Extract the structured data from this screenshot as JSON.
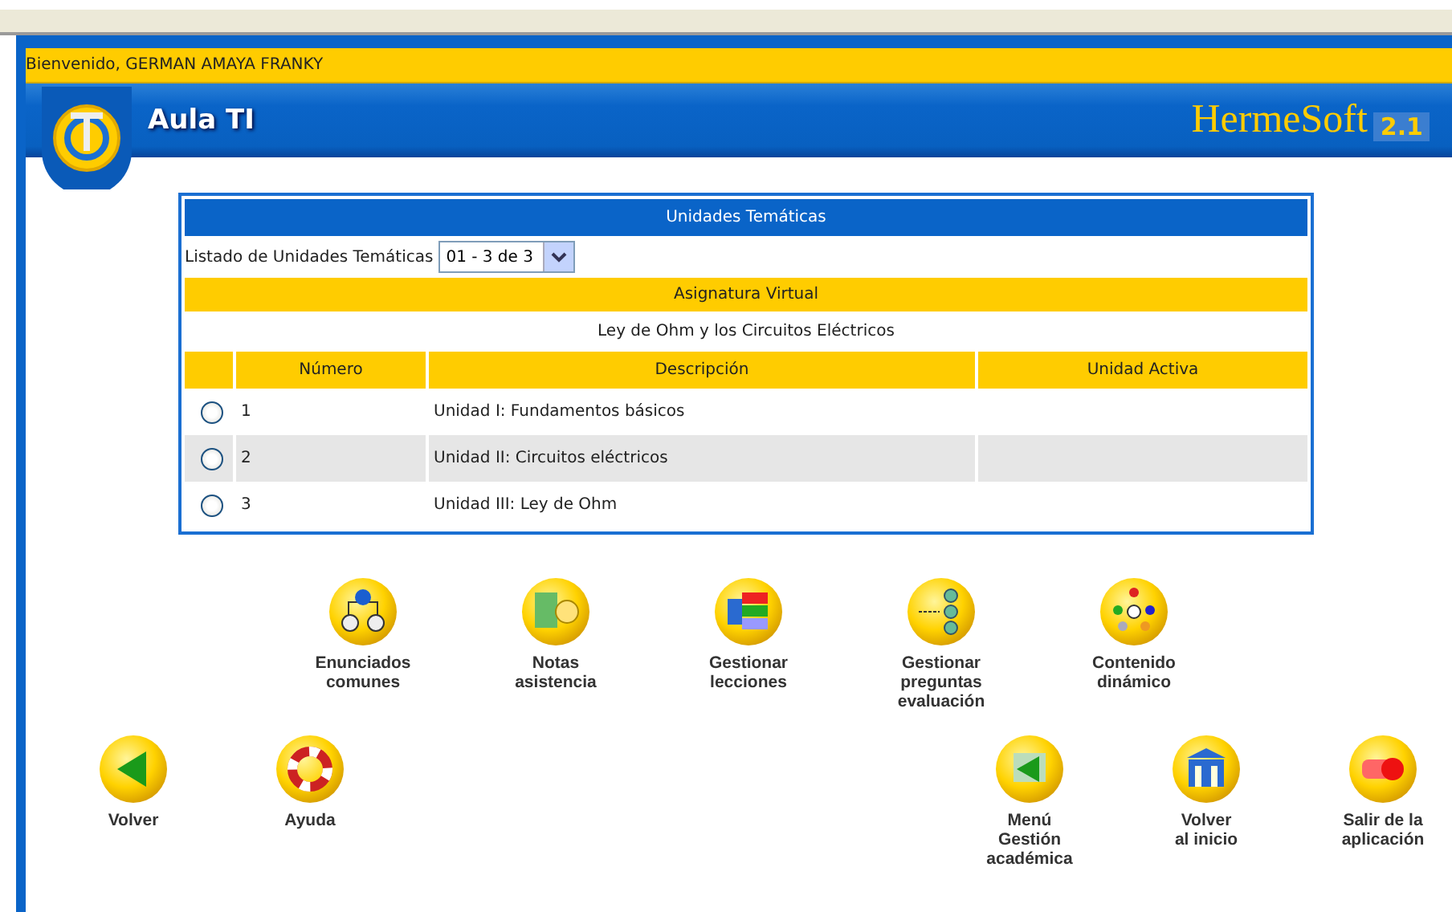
{
  "welcome": "Bienvenido, GERMAN AMAYA FRANKY",
  "header": {
    "title": "Aula TI",
    "brand": "HermeSoft",
    "version": "2.1"
  },
  "panel": {
    "title": "Unidades Temáticas",
    "list_label": "Listado de Unidades Temáticas",
    "list_value": "01 - 3 de 3",
    "subject_heading": "Asignatura Virtual",
    "subject": "Ley de Ohm y los Circuitos Eléctricos",
    "columns": [
      "Número",
      "Descripción",
      "Unidad Activa"
    ],
    "rows": [
      {
        "number": "1",
        "description": "Unidad I: Fundamentos básicos",
        "selected": false
      },
      {
        "number": "2",
        "description": "Unidad II: Circuitos eléctricos",
        "selected": false
      },
      {
        "number": "3",
        "description": "Unidad III: Ley de Ohm",
        "selected": false
      }
    ]
  },
  "tools": [
    {
      "kind": "tree",
      "label": "Enunciados\ncomunes"
    },
    {
      "kind": "grades",
      "label": "Notas\nasistencia"
    },
    {
      "kind": "lessons",
      "label": "Gestionar\nlecciones"
    },
    {
      "kind": "questions",
      "label": "Gestionar\npreguntas\nevaluación"
    },
    {
      "kind": "content",
      "label": "Contenido\ndinámico"
    }
  ],
  "nav_left": [
    {
      "kind": "back",
      "label": "Volver"
    },
    {
      "kind": "help",
      "label": "Ayuda"
    }
  ],
  "nav_right": [
    {
      "kind": "menu",
      "label": "Menú\nGestión\nacadémica"
    },
    {
      "kind": "home",
      "label": "Volver\nal inicio"
    },
    {
      "kind": "exit",
      "label": "Salir de la\naplicación"
    }
  ]
}
